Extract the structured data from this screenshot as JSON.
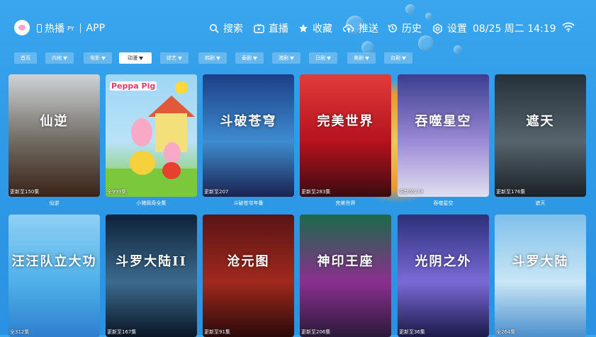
{
  "header": {
    "brand": "热播",
    "brand_sup": "PY",
    "app_label": "APP",
    "nav": [
      {
        "label": "搜索",
        "icon": "search-icon"
      },
      {
        "label": "直播",
        "icon": "tv-icon"
      },
      {
        "label": "收藏",
        "icon": "star-icon"
      },
      {
        "label": "推送",
        "icon": "cloud-upload-icon"
      },
      {
        "label": "历史",
        "icon": "history-icon"
      },
      {
        "label": "设置",
        "icon": "gear-icon"
      }
    ],
    "clock": "08/25 周二 14:19"
  },
  "filters": [
    {
      "label": "首页",
      "dropdown": false,
      "active": false
    },
    {
      "label": "内地",
      "dropdown": true,
      "active": false
    },
    {
      "label": "电影",
      "dropdown": true,
      "active": false
    },
    {
      "label": "动漫",
      "dropdown": true,
      "active": true
    },
    {
      "label": "综艺",
      "dropdown": true,
      "active": false
    },
    {
      "label": "韩剧",
      "dropdown": true,
      "active": false
    },
    {
      "label": "泰剧",
      "dropdown": true,
      "active": false
    },
    {
      "label": "港剧",
      "dropdown": true,
      "active": false
    },
    {
      "label": "日剧",
      "dropdown": true,
      "active": false
    },
    {
      "label": "美剧",
      "dropdown": true,
      "active": false
    },
    {
      "label": "台剧",
      "dropdown": true,
      "active": false
    }
  ],
  "cards": [
    {
      "badge": "更新至150集",
      "caption": "仙逆",
      "poster_text": "仙逆",
      "colors": [
        "#cfd3d6",
        "#6f6a62",
        "#3b2217"
      ]
    },
    {
      "badge": "全999集",
      "caption": "小猪佩奇全集",
      "poster_text": "",
      "colors": [
        "#9fd6f4",
        "#b9e2f7",
        "#7cc83c"
      ]
    },
    {
      "badge": "更新至207",
      "caption": "斗破苍穹年番",
      "poster_text": "斗破苍穹",
      "colors": [
        "#1b3f86",
        "#3f8cd0",
        "#1a2350"
      ]
    },
    {
      "badge": "更新至283集",
      "caption": "完美世界",
      "poster_text": "完美世界",
      "colors": [
        "#e23b3b",
        "#b5121e",
        "#3a0a10"
      ]
    },
    {
      "badge": "更新至238",
      "caption": "吞噬星空",
      "poster_text": "吞噬星空",
      "colors": [
        "#3b3d8f",
        "#9c8ad6",
        "#e0dff0"
      ]
    },
    {
      "badge": "更新至176集",
      "caption": "遮天",
      "poster_text": "遮天",
      "colors": [
        "#24303a",
        "#56646d",
        "#1a2026"
      ]
    },
    {
      "badge": "全312集",
      "caption": "",
      "poster_text": "汪汪队立大功",
      "colors": [
        "#8fd0f5",
        "#4fb0e8",
        "#2f7fd0"
      ]
    },
    {
      "badge": "更新至167集",
      "caption": "",
      "poster_text": "斗罗大陆II",
      "colors": [
        "#0e2138",
        "#3c6b8e",
        "#0a1626"
      ]
    },
    {
      "badge": "更新至91集",
      "caption": "",
      "poster_text": "沧元图",
      "colors": [
        "#5a1414",
        "#a0291d",
        "#2a0a0a"
      ]
    },
    {
      "badge": "更新至206集",
      "caption": "",
      "poster_text": "神印王座",
      "colors": [
        "#1b6a4a",
        "#8b2f8e",
        "#2a1a3a"
      ]
    },
    {
      "badge": "更新至36集",
      "caption": "",
      "poster_text": "光阴之外",
      "colors": [
        "#2c2f7a",
        "#7a6ad6",
        "#1b1a4a"
      ]
    },
    {
      "badge": "全264集",
      "caption": "",
      "poster_text": "斗罗大陆",
      "colors": [
        "#7fc0ea",
        "#c9e6f6",
        "#4b8fcc"
      ]
    }
  ]
}
